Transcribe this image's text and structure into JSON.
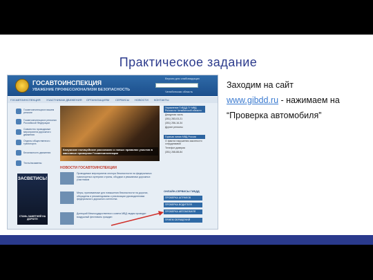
{
  "slide": {
    "title": "Практическое задание",
    "instruction_prefix": "Заходим на сайт",
    "link": "www.gibdd.ru",
    "instruction_suffix": " - нажимаем на “Проверка автомобиля”"
  },
  "site": {
    "name": "ГОСАВТОИНСПЕКЦИЯ",
    "motto": "УВАЖЕНИЕ  ПРОФЕССИОНАЛИЗМ  БЕЗОПАСНОСТЬ",
    "header_link": "Версия для слабовидящих",
    "region": "Челябинская область",
    "nav": [
      "ГОСАВТОИНСПЕКЦИЯ",
      "УЧАСТНИКАМ ДВИЖЕНИЯ",
      "ОРГАНИЗАЦИЯМ",
      "СЕРВИСЫ",
      "НОВОСТИ",
      "КОНТАКТЫ"
    ],
    "left_menu": [
      "Госавтоинспекция в вашем регионе",
      "Госавтоинспекция в регионах Российской Федерации",
      "Совместно проводимые мероприятия дорожного движения",
      "Отделы общественного транспорта",
      "Безопасность движения",
      "Тесты/экзамены"
    ],
    "banner_top": "ЗАСВЕТИСЬ!",
    "banner_bottom": "СТАНЬ ЗАМЕТНЕЙ НА ДОРОГЕ!",
    "photo_caption": "Калужские полицейские рассказали о новых правилах участия в массовых проверках Госавтоинспекции",
    "news_heading": "НОВОСТИ ГОСАВТОИНСПЕКЦИИ",
    "news": [
      "Проводимые мероприятия сектора безопасности на федеральных транспортных артериях страны, обсудим и уважаемых дорожных участников",
      "Меры, принимаемые для повышения безопасности на дорогах, обсуждены и рекомендованы к реализации руководителями федерального дорожного агентства",
      "Донецкий Межгосударственного совета МВД людям проводят воздушный фестиваль граждан"
    ],
    "right_box1_title": "Управление ГИБДД ГУ МВД России по Челябинской области",
    "right_box1_lines": [
      "Дежурная часть",
      "(351) 283-03-21",
      "(351) 256-16-34",
      "Другие регионы"
    ],
    "right_box2_title": "Горячая линия МВД России",
    "right_box2_lines": [
      "О фактах нарушения законности сотрудниками",
      "Телефон доверия",
      "(351) 268-88-84"
    ],
    "online_title": "ОНЛАЙН-СЕРВИСЫ ГИБДД",
    "online_buttons": [
      "ПРОВЕРКА ШТРАФОВ",
      "ПРОВЕРКА ВОДИТЕЛЯ",
      "ПРОВЕРКА АВТОМОБИЛЯ",
      "ПРИЕМ ОБРАЩЕНИЙ"
    ]
  },
  "colors": {
    "title": "#2b3a8c",
    "link": "#3a7ad0",
    "bar": "#2a3a8c",
    "arrow": "#d0302a"
  }
}
